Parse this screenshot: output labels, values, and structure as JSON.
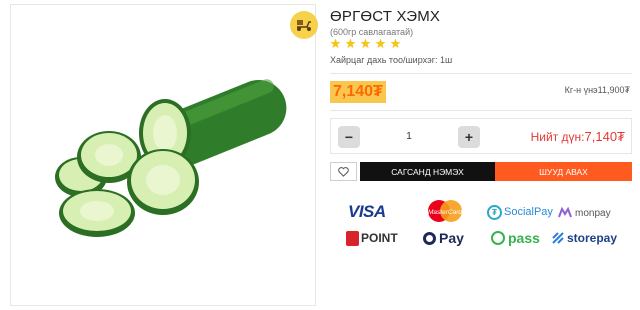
{
  "product": {
    "title": "ӨРГӨСТ ХЭМХ",
    "subtitle": "(600гр савлагаатай)",
    "rating_stars": 5,
    "pack_info": "Хайрцаг дахь тоо/ширхэг: 1ш",
    "image_alt": "cucumber",
    "delivery_icon": "delivery-scooter-icon"
  },
  "pricing": {
    "price": "7,140₮",
    "unit_price": "Кг-н үнэ11,900₮"
  },
  "quantity": {
    "minus_label": "−",
    "value": "1",
    "plus_label": "+",
    "total_label": "Нийт дүн:",
    "total_value": "7,140₮"
  },
  "actions": {
    "wishlist_icon": "heart-icon",
    "add_to_cart": "САГСАНД НЭМЭХ",
    "buy_now": "ШУУД АВАХ"
  },
  "payment_methods": {
    "visa": "VISA",
    "mastercard": "MasterCard",
    "socialpay": "SocialPay",
    "monpay": "monpay",
    "point": "POINT",
    "qpay": "Pay",
    "pass": "pass",
    "storepay": "storepay"
  },
  "colors": {
    "accent_orange": "#ff5a1f",
    "price_bg": "#f9c74f",
    "total_red": "#e53935",
    "star_yellow": "#f5c518"
  }
}
